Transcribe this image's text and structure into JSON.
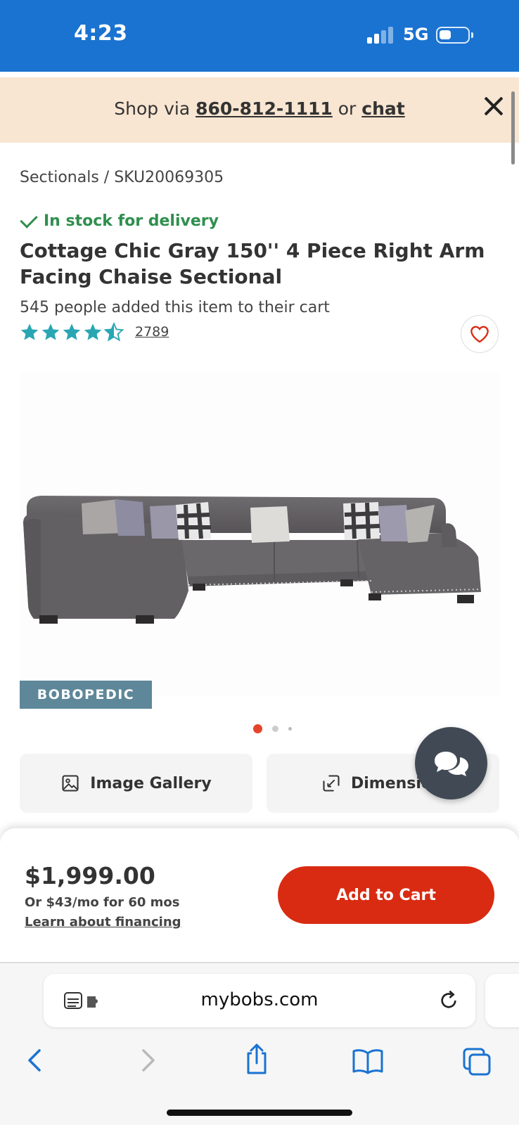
{
  "status_bar": {
    "time": "4:23",
    "network": "5G"
  },
  "promo": {
    "prefix": "Shop via ",
    "phone": "860-812-1111",
    "middle": " or ",
    "chat": "chat"
  },
  "breadcrumb": "Sectionals /  SKU20069305",
  "stock": "In stock for delivery",
  "product": {
    "title": "Cottage Chic Gray 150'' 4 Piece Right Arm Facing Chaise Sectional",
    "cart_count": "545 people added this item to their cart",
    "rating": 4.5,
    "review_count": "2789",
    "badge": "BOBOPEDIC"
  },
  "image_carousel": {
    "current": 1,
    "total": 3
  },
  "buttons": {
    "gallery": "Image Gallery",
    "dimensions": "Dimensions"
  },
  "purchase": {
    "price": "$1,999.00",
    "monthly": "Or $43/mo for 60 mos",
    "financing": "Learn about financing",
    "add_to_cart": "Add to Cart"
  },
  "browser": {
    "url": "mybobs.com"
  },
  "colors": {
    "brand_blue": "#1a73d1",
    "accent_red": "#d92b12",
    "stock_green": "#2f8f4e",
    "star_teal": "#2aa6b3"
  }
}
